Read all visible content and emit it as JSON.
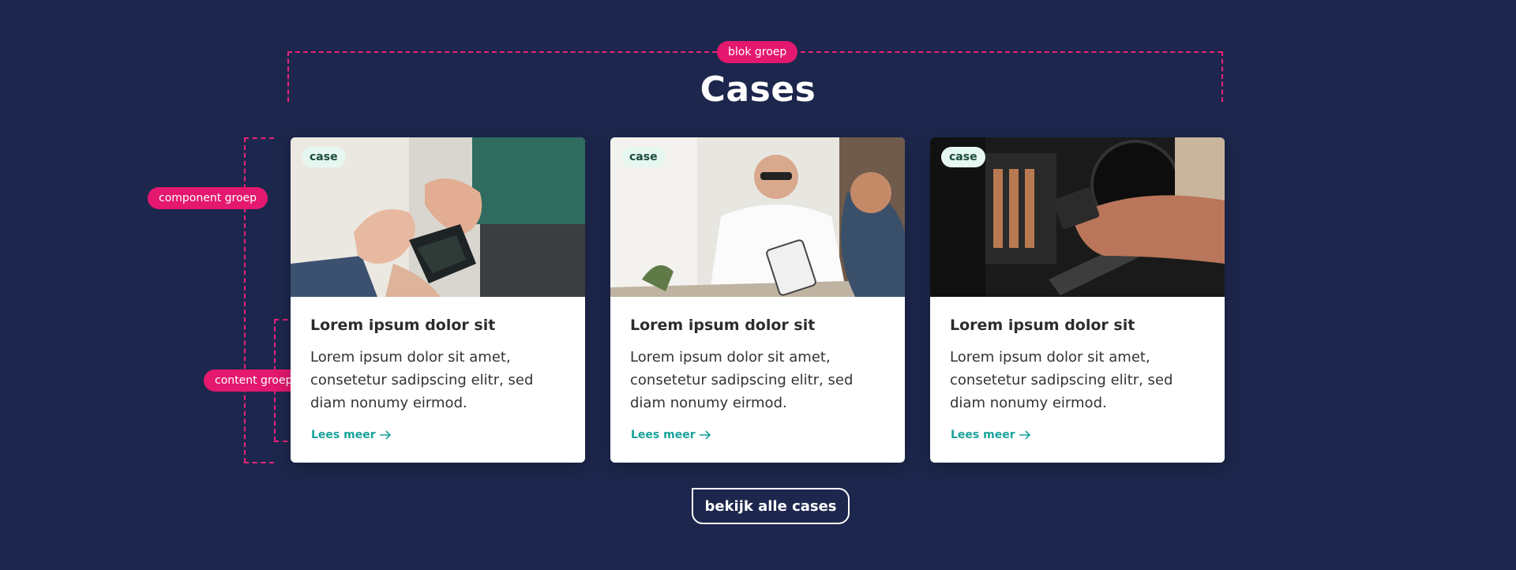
{
  "annotations": {
    "block_group": "blok groep",
    "component_group": "component groep",
    "content_group": "content groep"
  },
  "section": {
    "title": "Cases"
  },
  "cards": [
    {
      "tag": "case",
      "title": "Lorem ipsum dolor sit",
      "text": "Lorem ipsum dolor sit amet, consetetur sadipscing elitr, sed diam nonumy eirmod.",
      "link": "Lees meer"
    },
    {
      "tag": "case",
      "title": "Lorem ipsum dolor sit",
      "text": "Lorem ipsum dolor sit amet, consetetur sadipscing elitr, sed diam nonumy eirmod.",
      "link": "Lees meer"
    },
    {
      "tag": "case",
      "title": "Lorem ipsum dolor sit",
      "text": "Lorem ipsum dolor sit amet, consetetur sadipscing elitr, sed diam nonumy eirmod.",
      "link": "Lees meer"
    }
  ],
  "cta": {
    "label": "bekijk alle cases"
  },
  "colors": {
    "background": "#1d274d",
    "annotation": "#e3186e",
    "link": "#19a29a",
    "tag_background": "#e6f7f0"
  },
  "icons": {
    "link_arrow": "arrow-right-icon"
  }
}
